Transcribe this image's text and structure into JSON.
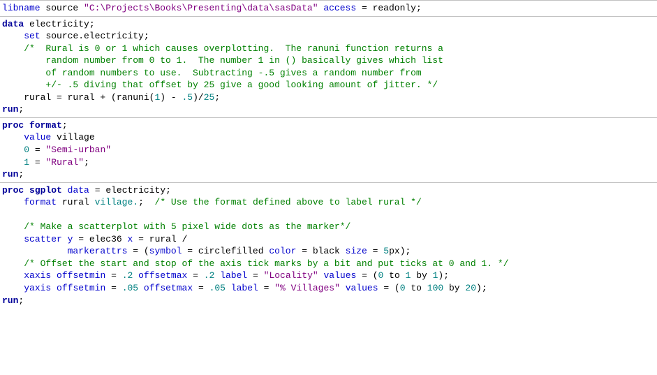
{
  "block1": {
    "libname": "libname",
    "source": "source",
    "path": "\"C:\\Projects\\Books\\Presenting\\data\\sasData\"",
    "access": "access",
    "eq": "=",
    "readonly": "readonly",
    "semi": ";"
  },
  "block2": {
    "data_kw": "data",
    "data_name": "electricity",
    "set_kw": "set",
    "set_ds": "source.electricity",
    "comment1": "/*  Rural is 0 or 1 which causes overplotting.  The ranuni function returns a",
    "comment2": "        random number from 0 to 1.  The number 1 in () basically gives which list",
    "comment3": "        of random numbers to use.  Subtracting -.5 gives a random number from",
    "comment4": "        +/- .5 diving that offset by 25 give a good looking amount of jitter. */",
    "assign_lhs": "rural = rural + (ranuni(",
    "num1": "1",
    "mid": ") - ",
    "num05": ".5",
    "mid2": ")/",
    "num25": "25",
    "run": "run",
    "semi": ";"
  },
  "block3": {
    "proc": "proc",
    "format": "format",
    "value_kw": "value",
    "value_name": "village",
    "v0": "0",
    "eq": "=",
    "s0": "\"Semi-urban\"",
    "v1": "1",
    "s1": "\"Rural\"",
    "run": "run",
    "semi": ";"
  },
  "block4": {
    "proc": "proc",
    "sgplot": "sgplot",
    "data_kw": "data",
    "eq": "=",
    "data_ds": "electricity",
    "format_kw": "format",
    "format_var": "rural",
    "format_fmt": "village.",
    "cmt_fmt": "/* Use the format defined above to label rural */",
    "cmt_scatter": "/* Make a scatterplot with 5 pixel wide dots as the marker*/",
    "scatter_kw": "scatter",
    "y_kw": "y",
    "y_var": "elec36",
    "x_kw": "x",
    "x_var": "rural",
    "slash": "/",
    "markerattrs_kw": "markerattrs",
    "open": "= (",
    "symbol_kw": "symbol",
    "symbol_val": "circlefilled",
    "color_kw": "color",
    "color_val": "black",
    "size_kw": "size",
    "size_val": "5",
    "size_unit": "px",
    "close": ");",
    "cmt_axis": "/* Offset the start and stop of the axis tick marks by a bit and put ticks at 0 and 1. */",
    "xaxis_kw": "xaxis",
    "yaxis_kw": "yaxis",
    "offsetmin_kw": "offsetmin",
    "offsetmax_kw": "offsetmax",
    "x_offmin": ".2",
    "x_offmax": ".2",
    "y_offmin": ".05",
    "y_offmax": ".05",
    "label_kw": "label",
    "x_label": "\"Locality\"",
    "y_label": "\"% Villages\"",
    "values_kw": "values",
    "x_v0": "0",
    "x_v1": "1",
    "x_vby": "1",
    "y_v0": "0",
    "y_v1": "100",
    "y_vby": "20",
    "to_kw": "to",
    "by_kw": "by",
    "run": "run",
    "semi": ";"
  }
}
